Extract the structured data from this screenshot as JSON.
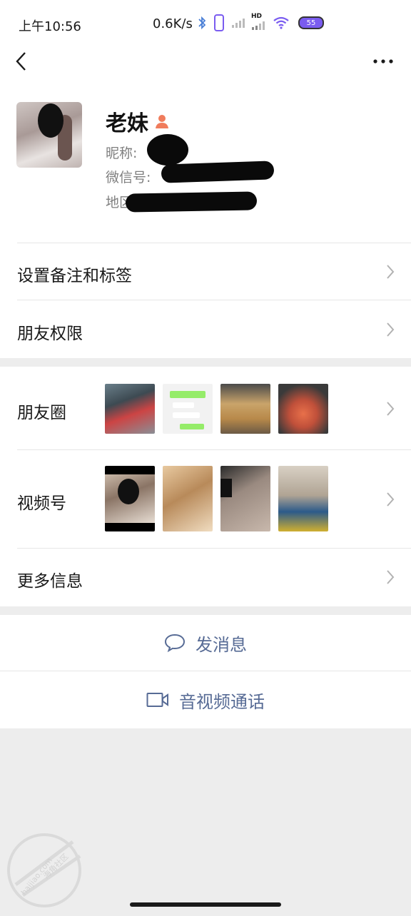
{
  "status_bar": {
    "time": "上午10:56",
    "network_speed": "0.6K/s",
    "hd_label": "HD",
    "battery": "55"
  },
  "nav": {
    "back_icon": "chevron-left-icon",
    "more_icon": "more-dots-icon"
  },
  "profile": {
    "name": "老妹",
    "gender_icon": "female-person-icon",
    "gender_color": "#f07c5c",
    "nickname_label": "昵称:",
    "wechat_id_label": "微信号:",
    "region_label": "地区"
  },
  "menu": {
    "remark_tags": "设置备注和标签",
    "friend_permissions": "朋友权限",
    "moments": "朋友圈",
    "channels": "视频号",
    "more_info": "更多信息"
  },
  "actions": {
    "send_message": "发消息",
    "message_icon": "chat-bubble-icon",
    "video_call": "音视频通话",
    "video_icon": "video-camera-icon",
    "accent_color": "#576b95"
  },
  "watermark": {
    "text": "海角社区",
    "url": "haijiao.com"
  }
}
